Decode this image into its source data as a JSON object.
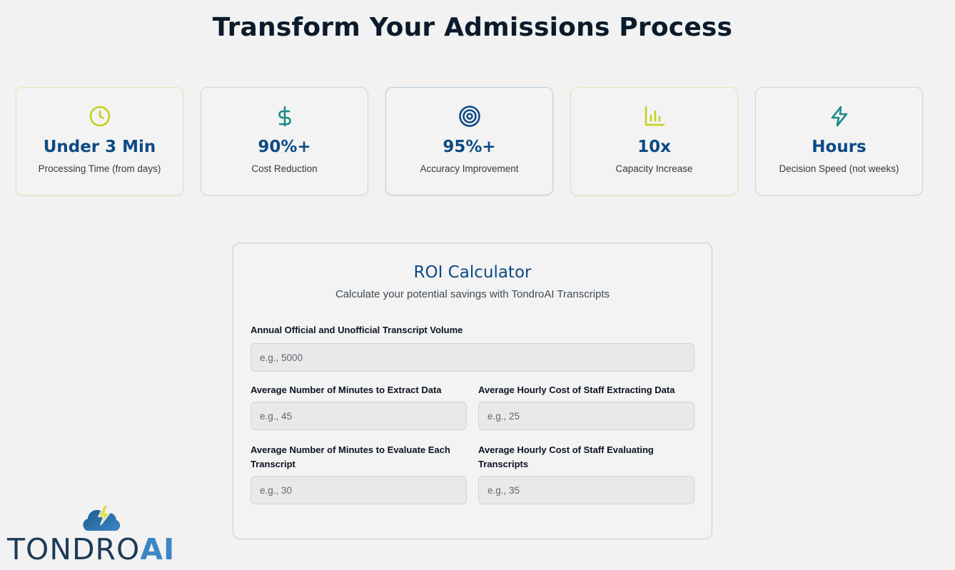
{
  "page": {
    "title": "Transform Your Admissions Process"
  },
  "stats": [
    {
      "icon": "clock-icon",
      "value": "Under 3 Min",
      "label": "Processing Time (from days)",
      "accent": "#c6d11a"
    },
    {
      "icon": "dollar-icon",
      "value": "90%+",
      "label": "Cost Reduction",
      "accent": "#1a8a8a"
    },
    {
      "icon": "target-icon",
      "value": "95%+",
      "label": "Accuracy Improvement",
      "accent": "#0d4a85"
    },
    {
      "icon": "bar-chart-icon",
      "value": "10x",
      "label": "Capacity Increase",
      "accent": "#c6d11a"
    },
    {
      "icon": "lightning-icon",
      "value": "Hours",
      "label": "Decision Speed (not weeks)",
      "accent": "#1a8a8a"
    }
  ],
  "calculator": {
    "title": "ROI Calculator",
    "subtitle": "Calculate your potential savings with TondroAI Transcripts",
    "fields": {
      "volume": {
        "label": "Annual Official and Unofficial Transcript Volume",
        "placeholder": "e.g., 5000",
        "value": ""
      },
      "extract_minutes": {
        "label": "Average Number of Minutes to Extract Data",
        "placeholder": "e.g., 45",
        "value": ""
      },
      "extract_cost": {
        "label": "Average Hourly Cost of Staff Extracting Data",
        "placeholder": "e.g., 25",
        "value": ""
      },
      "evaluate_minutes": {
        "label": "Average Number of Minutes to Evaluate Each Transcript",
        "placeholder": "e.g., 30",
        "value": ""
      },
      "evaluate_cost": {
        "label": "Average Hourly Cost of Staff Evaluating Transcripts",
        "placeholder": "e.g., 35",
        "value": ""
      }
    }
  },
  "logo": {
    "text_main": "TONDRO",
    "text_accent": "AI"
  },
  "colors": {
    "brand_blue": "#0d4a85",
    "lime": "#c6d11a",
    "teal": "#1a8a8a",
    "background": "#f2f2f2"
  }
}
